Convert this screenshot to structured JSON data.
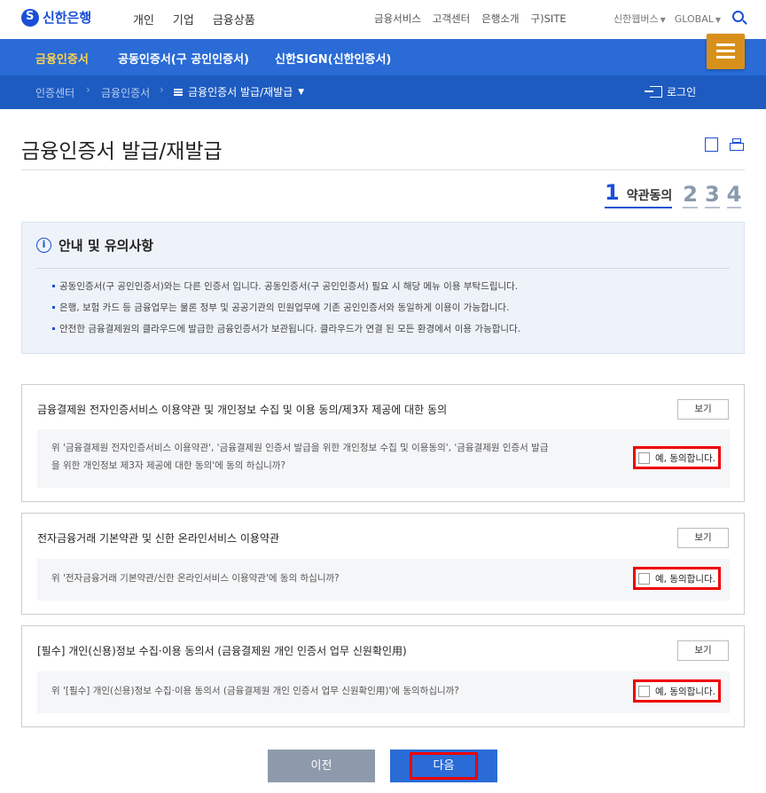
{
  "header": {
    "logo_text": "신한은행",
    "gnb": [
      "개인",
      "기업",
      "금융상품"
    ],
    "util": [
      "금융서비스",
      "고객센터",
      "은행소개",
      "구)SITE"
    ],
    "family_sites": "신한웹버스",
    "language": "GLOBAL"
  },
  "nav": {
    "tabs": [
      "금융인증서",
      "공동인증서(구 공인인증서)",
      "신한SIGN(신한인증서)"
    ],
    "breadcrumb": [
      "인증센터",
      "금융인증서"
    ],
    "current": "금융인증서 발급/재발급",
    "login_label": "로그인"
  },
  "page": {
    "title": "금융인증서 발급/재발급"
  },
  "steps": {
    "active_number": "1",
    "active_label": "약관동의",
    "others": [
      "2",
      "3",
      "4"
    ]
  },
  "notice": {
    "title": "안내 및 유의사항",
    "items": [
      "공동인증서(구 공인인증서)와는 다른 인증서 입니다. 공동인증서(구 공인인증서) 필요 시 해당 메뉴 이용 부탁드립니다.",
      "은행, 보험 카드 등 금융업무는 물론 정부 및 공공기관의 민원업무에 기존 공인인증서와 동일하게 이용이 가능합니다.",
      "안전한 금융결제원의 클라우드에 발급한 금융인증서가 보관됩니다. 클라우드가 연결 된 모든 환경에서 이용 가능합니다."
    ]
  },
  "agreements": [
    {
      "title": "금융결제원 전자인증서비스 이용약관 및 개인정보 수집 및 이용 동의/제3자 제공에 대한 동의",
      "view_label": "보기",
      "question_line1": "위 '금융결제원 전자인증서비스 이용약관', '금융결제원 인증서 발급을 위한 개인정보 수집 및 이용동의', '금융결제원 인증서 발급",
      "question_line2": "을 위한 개인정보 제3자 제공에 대한 동의'에 동의 하십니까?",
      "consent_label": "예, 동의합니다."
    },
    {
      "title": "전자금융거래 기본약관 및 신한 온라인서비스 이용약관",
      "view_label": "보기",
      "question_line1": "위 '전자금융거래 기본약관/신한 온라인서비스 이용약관'에 동의 하십니까?",
      "consent_label": "예, 동의합니다."
    },
    {
      "title": "[필수] 개인(신용)정보 수집·이용 동의서 (금융결제원 개인 인증서 업무 신원확인用)",
      "view_label": "보기",
      "question_line1": "위 '[필수] 개인(신용)정보 수집·이용 동의서 (금융결제원 개인 인증서 업무 신원확인用)'에 동의하십니까?",
      "consent_label": "예, 동의합니다."
    }
  ],
  "buttons": {
    "prev": "이전",
    "next": "다음"
  }
}
